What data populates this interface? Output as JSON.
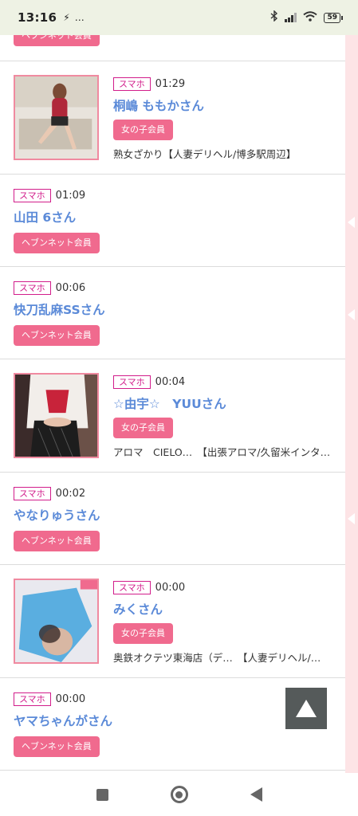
{
  "status_bar": {
    "time": "13:16",
    "extra": "…",
    "battery": "59"
  },
  "rows": [
    {
      "badge": "ヘブンネット会員"
    },
    {
      "tag": "スマホ",
      "time": "01:29",
      "name": "桐嶋 ももかさん",
      "badge": "女の子会員",
      "shop": "熟女ざかり【人妻デリヘル/博多駅周辺】"
    },
    {
      "tag": "スマホ",
      "time": "01:09",
      "name": "山田 6さん",
      "badge": "ヘブンネット会員"
    },
    {
      "tag": "スマホ",
      "time": "00:06",
      "name": "快刀乱麻SSさん",
      "badge": "ヘブンネット会員"
    },
    {
      "tag": "スマホ",
      "time": "00:04",
      "name": "☆由宇☆　YUUさん",
      "badge": "女の子会員",
      "shop": "アロマ　CIELO…　【出張アロマ/久留米インタ…"
    },
    {
      "tag": "スマホ",
      "time": "00:02",
      "name": "やなりゅうさん",
      "badge": "ヘブンネット会員"
    },
    {
      "tag": "スマホ",
      "time": "00:00",
      "name": "みくさん",
      "badge": "女の子会員",
      "shop": "奥鉄オクテツ東海店（デ…　【人妻デリヘル/…"
    },
    {
      "tag": "スマホ",
      "time": "00:00",
      "name": "ヤマちゃんがさん",
      "badge": "ヘブンネット会員"
    }
  ],
  "colors": {
    "accent_pink": "#f06a8e",
    "tag_magenta": "#d21d8b",
    "name_blue": "#5b8ad8",
    "side_strip": "#fde4e6"
  },
  "icons": [
    "bolt-icon",
    "wifi-icon",
    "signal-icon",
    "bluetooth-icon",
    "battery-icon",
    "scroll-top-icon",
    "nav-recents-icon",
    "nav-home-icon",
    "nav-back-icon"
  ]
}
